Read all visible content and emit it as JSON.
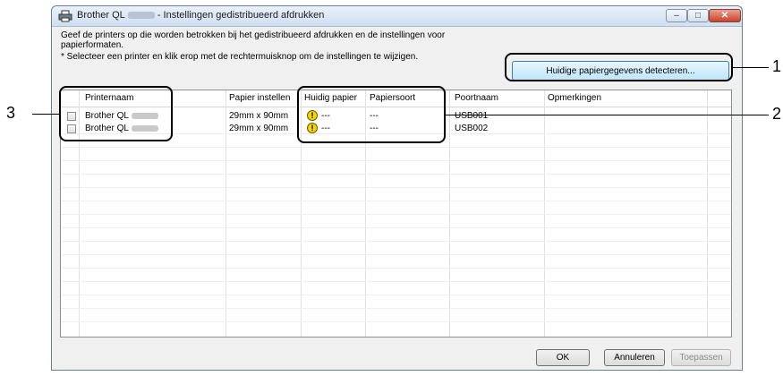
{
  "window": {
    "title_prefix": "Brother QL",
    "title_suffix": "- Instellingen gedistribueerd afdrukken",
    "controls": {
      "minimize": "–",
      "maximize": "□",
      "close": "✕"
    }
  },
  "description": "Geef de printers op die worden betrokken bij het gedistribueerd afdrukken en de instellingen voor papierformaten.",
  "hint": "* Selecteer een printer en klik erop met de rechtermuisknop om de instellingen te wijzigen.",
  "detect_button": "Huidige papiergegevens detecteren...",
  "table": {
    "columns": [
      "Printernaam",
      "Papier instellen",
      "Huidig papier",
      "Papiersoort",
      "Poortnaam",
      "Opmerkingen"
    ],
    "rows": [
      {
        "printer": "Brother QL",
        "paper_setting": "29mm x 90mm",
        "current_paper": "---",
        "paper_type": "---",
        "port": "USB001",
        "checked": false
      },
      {
        "printer": "Brother QL",
        "paper_setting": "29mm x 90mm",
        "current_paper": "---",
        "paper_type": "---",
        "port": "USB002",
        "checked": false
      }
    ]
  },
  "buttons": {
    "ok": "OK",
    "cancel": "Annuleren",
    "apply": "Toepassen"
  },
  "callouts": {
    "one": "1",
    "two": "2",
    "three": "3"
  },
  "icons": {
    "printer": "printer-icon",
    "warning": "warning-icon"
  },
  "colors": {
    "warning": "#f5d400",
    "accent": "#3c7fb1"
  }
}
